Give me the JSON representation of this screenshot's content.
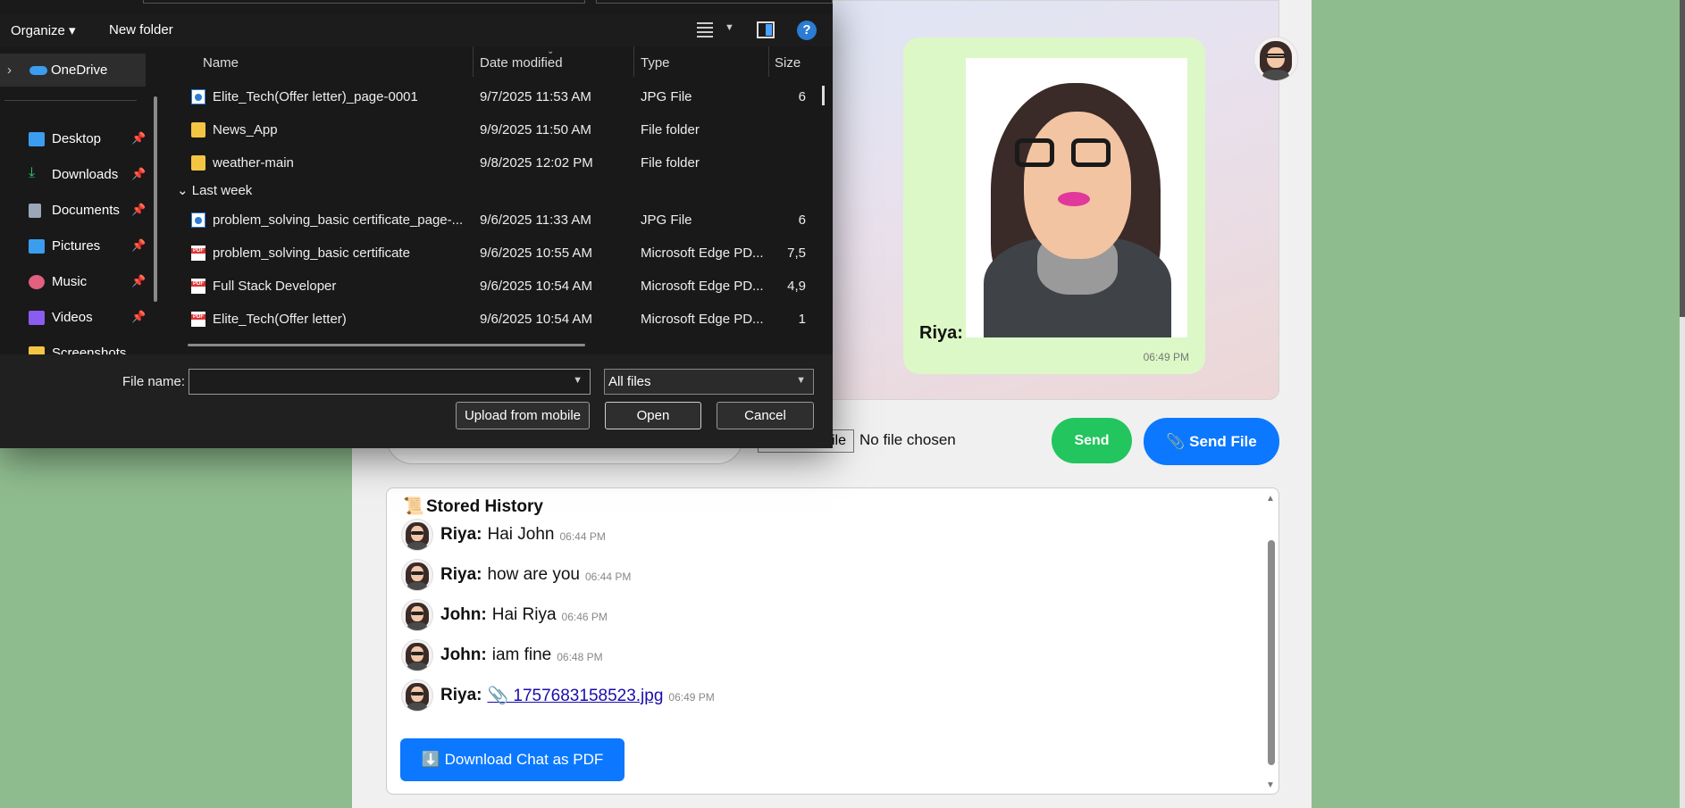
{
  "chat": {
    "bubble": {
      "sender": "Riya:",
      "time": "06:49 PM"
    },
    "input": {
      "choose_file_fragment": "ile",
      "no_file": "No file chosen"
    },
    "send_label": "Send",
    "send_file_label": "📎 Send File"
  },
  "history": {
    "icon": "📜",
    "title": "Stored History",
    "messages": [
      {
        "sender": "Riya:",
        "text": "Hai John",
        "time": "06:44 PM"
      },
      {
        "sender": "Riya:",
        "text": "how are you",
        "time": "06:44 PM"
      },
      {
        "sender": "John:",
        "text": "Hai Riya",
        "time": "06:46 PM"
      },
      {
        "sender": "John:",
        "text": "iam fine",
        "time": "06:48 PM"
      },
      {
        "sender": "Riya:",
        "text": "📎 1757683158523.jpg",
        "time": "06:49 PM",
        "is_link": true
      }
    ],
    "download_label": "⬇️ Download Chat as PDF"
  },
  "dialog": {
    "toolbar": {
      "organize": "Organize ▾",
      "new_folder": "New folder",
      "help": "?"
    },
    "nav": {
      "onedrive": "OneDrive",
      "items": [
        {
          "label": "Desktop",
          "icon": "desktop-icon",
          "color": "#3b9df0"
        },
        {
          "label": "Downloads",
          "icon": "download-icon",
          "color": "#2ecc71"
        },
        {
          "label": "Documents",
          "icon": "documents-icon",
          "color": "#9aa7b8"
        },
        {
          "label": "Pictures",
          "icon": "pictures-icon",
          "color": "#3b9df0"
        },
        {
          "label": "Music",
          "icon": "music-icon",
          "color": "#e0607e"
        },
        {
          "label": "Videos",
          "icon": "videos-icon",
          "color": "#8a5cf0"
        },
        {
          "label": "Screenshots",
          "icon": "folder-icon",
          "color": "#f4c542"
        }
      ]
    },
    "columns": {
      "name": "Name",
      "date": "Date modified",
      "type": "Type",
      "size": "Size"
    },
    "files_recent": [
      {
        "name": "Elite_Tech(Offer letter)_page-0001",
        "date": "9/7/2025 11:53 AM",
        "type": "JPG File",
        "size": "6",
        "kind": "jpg"
      },
      {
        "name": "News_App",
        "date": "9/9/2025 11:50 AM",
        "type": "File folder",
        "size": "",
        "kind": "folder"
      },
      {
        "name": "weather-main",
        "date": "9/8/2025 12:02 PM",
        "type": "File folder",
        "size": "",
        "kind": "folder"
      }
    ],
    "group_last_week": "Last week",
    "files_lastweek": [
      {
        "name": "problem_solving_basic certificate_page-...",
        "date": "9/6/2025 11:33 AM",
        "type": "JPG File",
        "size": "6",
        "kind": "jpg"
      },
      {
        "name": "problem_solving_basic certificate",
        "date": "9/6/2025 10:55 AM",
        "type": "Microsoft Edge PD...",
        "size": "7,5",
        "kind": "pdf"
      },
      {
        "name": "Full Stack Developer",
        "date": "9/6/2025 10:54 AM",
        "type": "Microsoft Edge PD...",
        "size": "4,9",
        "kind": "pdf"
      },
      {
        "name": "Elite_Tech(Offer letter)",
        "date": "9/6/2025 10:54 AM",
        "type": "Microsoft Edge PD...",
        "size": "1",
        "kind": "pdf"
      }
    ],
    "footer": {
      "file_name_label": "File name:",
      "file_name_value": "",
      "filter": "All files",
      "upload_label": "Upload from mobile",
      "open_label": "Open",
      "cancel_label": "Cancel"
    }
  }
}
